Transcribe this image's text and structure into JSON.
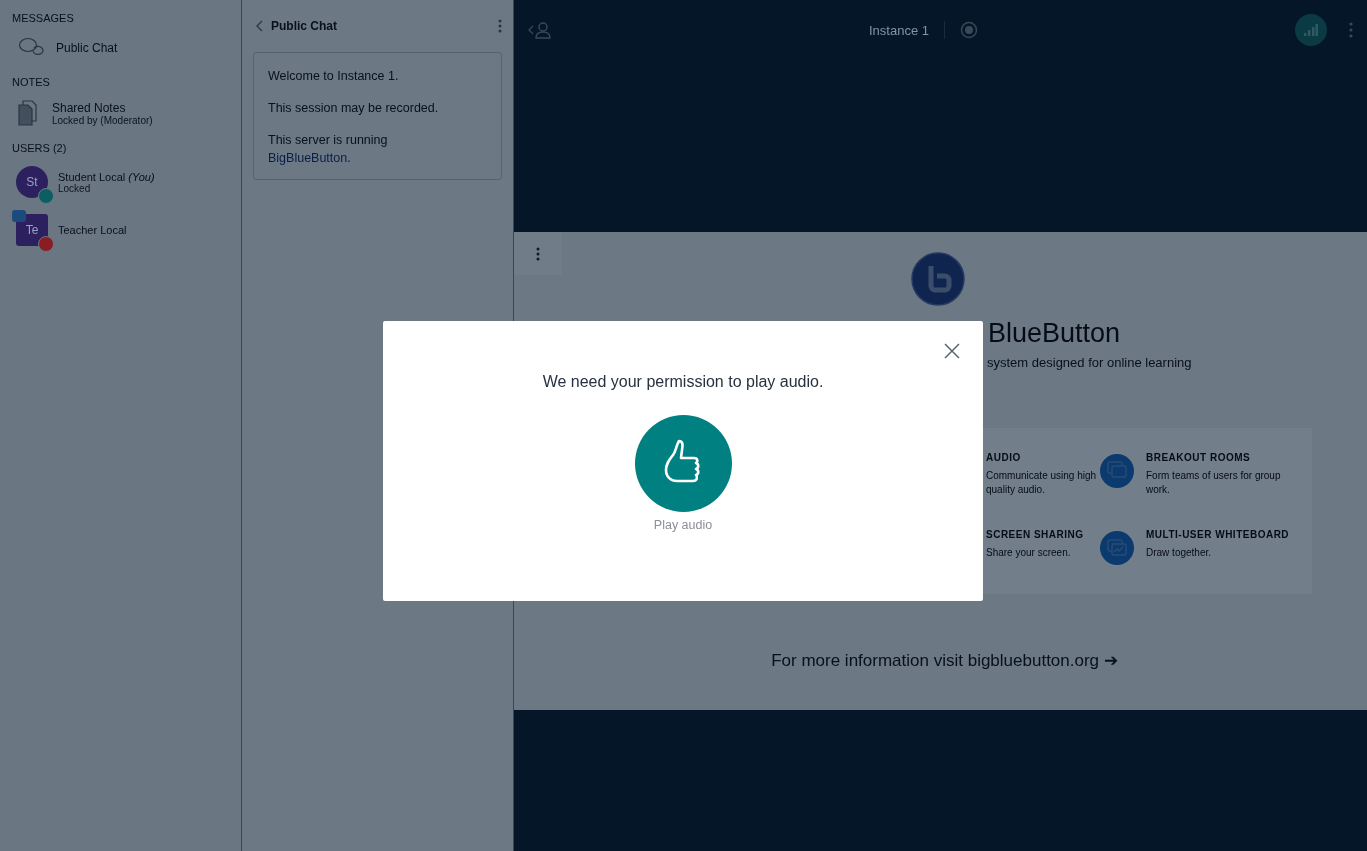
{
  "sidebar": {
    "messages": {
      "title": "MESSAGES",
      "items": [
        {
          "label": "Public Chat"
        }
      ]
    },
    "notes": {
      "title": "NOTES",
      "items": [
        {
          "label": "Shared Notes",
          "status": "Locked by (Moderator)"
        }
      ]
    },
    "users": {
      "title": "USERS (2)",
      "items": [
        {
          "initials": "St",
          "name": "Student Local",
          "tag": "(You)",
          "status": "Locked",
          "kind": "viewer",
          "presenter": false,
          "muted": false
        },
        {
          "initials": "Te",
          "name": "Teacher Local",
          "kind": "moderator",
          "presenter": true,
          "muted": true
        }
      ]
    }
  },
  "chat": {
    "title": "Public Chat",
    "messages": [
      {
        "text": "Welcome to Instance 1."
      },
      {
        "text": "This session may be recorded."
      },
      {
        "text": "This server is running",
        "link": "BigBlueButton",
        "after": "."
      }
    ]
  },
  "topbar": {
    "title": "Instance 1"
  },
  "slide": {
    "title": "BlueButton",
    "subtitle": "system designed for online learning",
    "features": [
      {
        "title": "AUDIO",
        "text": "Communicate using high quality audio."
      },
      {
        "title": "BREAKOUT ROOMS",
        "text": "Form teams of users for group work."
      },
      {
        "title": "SCREEN SHARING",
        "text": "Share your screen."
      },
      {
        "title": "MULTI-USER WHITEBOARD",
        "text": "Draw together."
      }
    ],
    "footer": "For more information visit bigbluebutton.org ➔"
  },
  "modal": {
    "message": "We need your permission to play audio.",
    "button": "Play audio"
  }
}
